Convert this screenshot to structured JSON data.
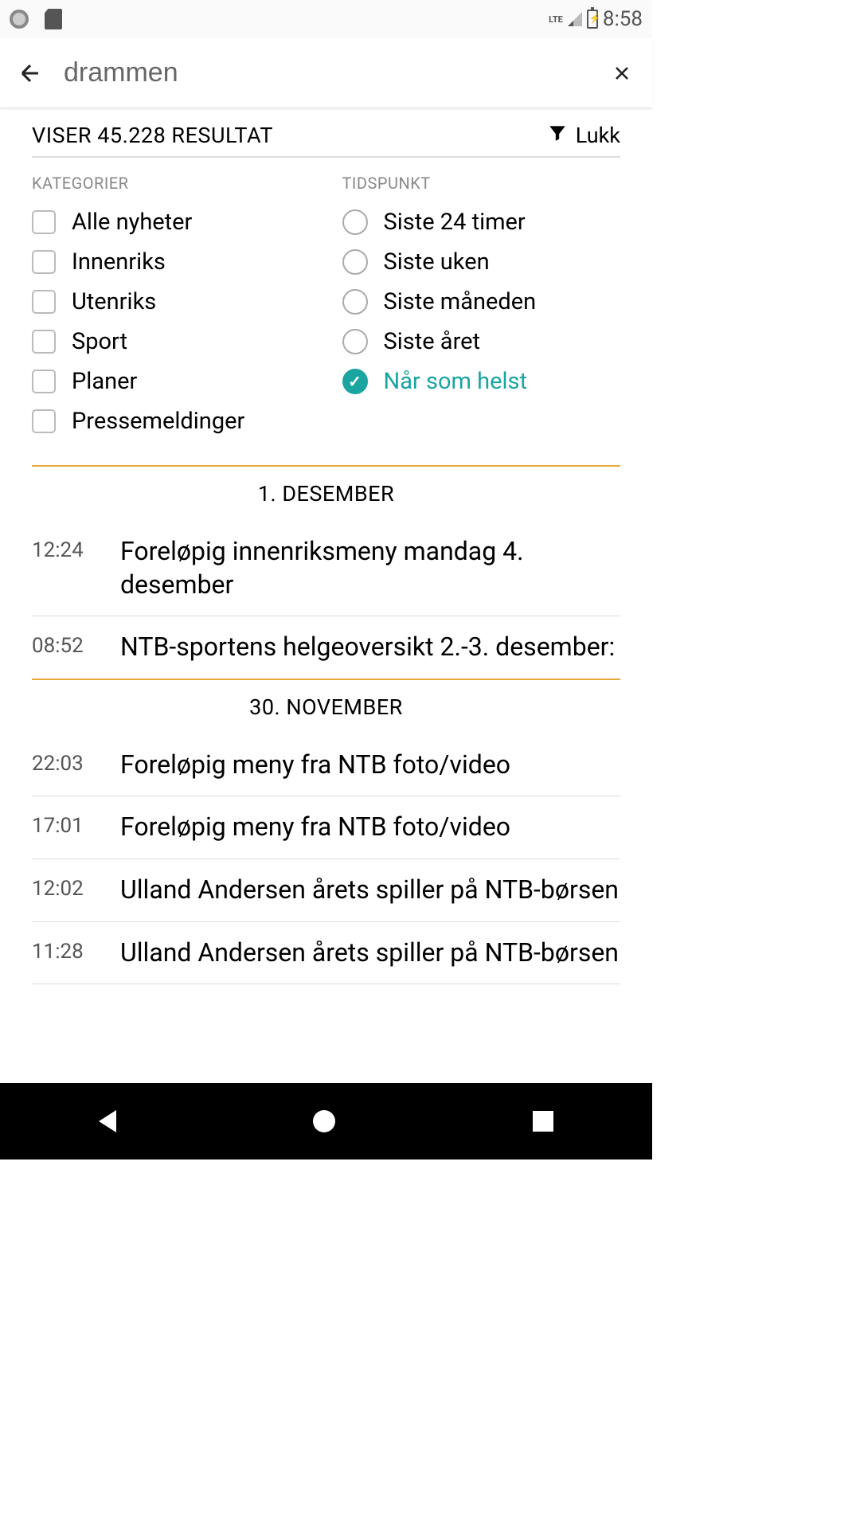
{
  "status": {
    "lte": "LTE",
    "time": "8:58"
  },
  "search": {
    "query": "drammen"
  },
  "header": {
    "results_text": "VISER 45.228 RESULTAT",
    "toggle_label": "Lukk"
  },
  "filters": {
    "categories_label": "KATEGORIER",
    "time_label": "TIDSPUNKT",
    "categories": [
      "Alle nyheter",
      "Innenriks",
      "Utenriks",
      "Sport",
      "Planer",
      "Pressemeldinger"
    ],
    "times": [
      {
        "label": "Siste 24 timer",
        "selected": false
      },
      {
        "label": "Siste uken",
        "selected": false
      },
      {
        "label": "Siste måneden",
        "selected": false
      },
      {
        "label": "Siste året",
        "selected": false
      },
      {
        "label": "Når som helst",
        "selected": true
      }
    ]
  },
  "sections": [
    {
      "header": "1. DESEMBER",
      "items": [
        {
          "time": "12:24",
          "title": "Foreløpig innenriksmeny mandag 4. desember"
        },
        {
          "time": "08:52",
          "title": "NTB-sportens helgeoversikt 2.-3. desember:"
        }
      ]
    },
    {
      "header": "30. NOVEMBER",
      "items": [
        {
          "time": "22:03",
          "title": "Foreløpig meny fra NTB foto/video"
        },
        {
          "time": "17:01",
          "title": "Foreløpig meny fra NTB foto/video"
        },
        {
          "time": "12:02",
          "title": "Ulland Andersen årets spiller på NTB-børsen"
        },
        {
          "time": "11:28",
          "title": "Ulland Andersen årets spiller på NTB-børsen"
        }
      ]
    }
  ]
}
